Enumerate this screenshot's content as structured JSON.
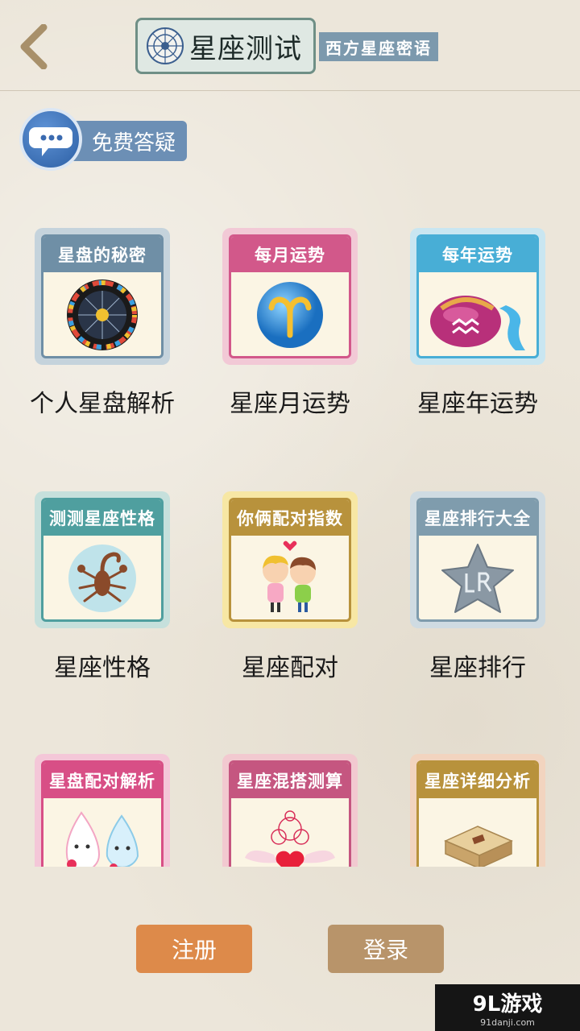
{
  "header": {
    "back_icon": "chevron-left-icon",
    "title_icon": "zodiac-wheel-icon",
    "title": "星座测试",
    "subtitle": "西方星座密语"
  },
  "faq": {
    "icon": "chat-bubble-icon",
    "label": "免费答疑"
  },
  "tiles": [
    {
      "band": "星盘的秘密",
      "label": "个人星盘解析",
      "icon": "natal-chart-wheel-icon",
      "color": "#6f8fa6"
    },
    {
      "band": "每月运势",
      "label": "星座月运势",
      "icon": "aries-symbol-icon",
      "color": "#d2588a"
    },
    {
      "band": "每年运势",
      "label": "星座年运势",
      "icon": "aquarius-jar-icon",
      "color": "#48aed6"
    },
    {
      "band": "测测星座性格",
      "label": "星座性格",
      "icon": "scorpion-icon",
      "color": "#4f9f9f"
    },
    {
      "band": "你俩配对指数",
      "label": "星座配对",
      "icon": "kissing-couple-icon",
      "color": "#b8923c"
    },
    {
      "band": "星座排行大全",
      "label": "星座排行",
      "icon": "stone-star-icon",
      "color": "#7f9cad"
    },
    {
      "band": "星盘配对解析",
      "label": "",
      "icon": "water-drop-couple-icon",
      "color": "#d84f86"
    },
    {
      "band": "星座混搭测算",
      "label": "",
      "icon": "winged-heart-icon",
      "color": "#c55680"
    },
    {
      "band": "星座详细分析",
      "label": "",
      "icon": "wooden-box-icon",
      "color": "#b8923c"
    }
  ],
  "buttons": {
    "register": "注册",
    "login": "登录",
    "register_color": "#dd8a4a",
    "login_color": "#b8946a"
  },
  "watermark": {
    "main": "9L游戏",
    "sub": "91danji.com"
  }
}
